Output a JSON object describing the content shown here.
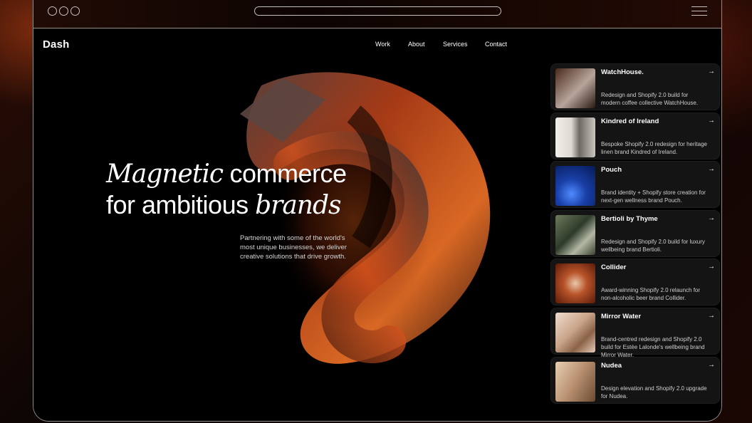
{
  "site": {
    "logo": "Dash",
    "nav": [
      "Work",
      "About",
      "Services",
      "Contact"
    ],
    "headline": {
      "line1_italic": "Magnetic",
      "line1_rest": " commerce",
      "line2_start": "for ambitious ",
      "line2_italic": "brands"
    },
    "subcopy": "Partnering with some of the world's most unique businesses, we deliver creative solutions that drive growth."
  },
  "projects": [
    {
      "title": "WatchHouse.",
      "desc": "Redesign and Shopify 2.0 build for modern coffee collective WatchHouse.",
      "thumb_colors": [
        "#4a2a1c",
        "#b7a49a"
      ]
    },
    {
      "title": "Kindred of Ireland",
      "desc": "Bespoke Shopify 2.0 redesign for heritage linen brand Kindred of Ireland.",
      "thumb_colors": [
        "#e8e6e2",
        "#8a8580"
      ]
    },
    {
      "title": "Pouch",
      "desc": "Brand identity + Shopify store creation for next-gen wellness brand Pouch.",
      "thumb_colors": [
        "#0a2a7a",
        "#2f6ad9"
      ]
    },
    {
      "title": "Bertioli by Thyme",
      "desc": "Redesign and Shopify 2.0 build for luxury wellbeing brand Bertioli.",
      "thumb_colors": [
        "#2e3a2a",
        "#9fae8c"
      ]
    },
    {
      "title": "Collider",
      "desc": "Award-winning Shopify 2.0 relaunch for non-alcoholic beer brand Collider.",
      "thumb_colors": [
        "#8a2a10",
        "#e0a47a"
      ]
    },
    {
      "title": "Mirror Water",
      "desc": "Brand-centred redesign and Shopify 2.0 build for Estée Lalonde's wellbeing brand Mirror Water.",
      "thumb_colors": [
        "#c9a48a",
        "#f0ddcf"
      ]
    },
    {
      "title": "Nudea",
      "desc": "Design elevation and Shopify 2.0 upgrade for Nudea.",
      "thumb_colors": [
        "#b89070",
        "#e8cfb4"
      ]
    }
  ],
  "icons": {
    "arrow": "→"
  },
  "colors": {
    "accent": "#e0561c",
    "card_bg": "#141414",
    "text": "#ffffff"
  }
}
